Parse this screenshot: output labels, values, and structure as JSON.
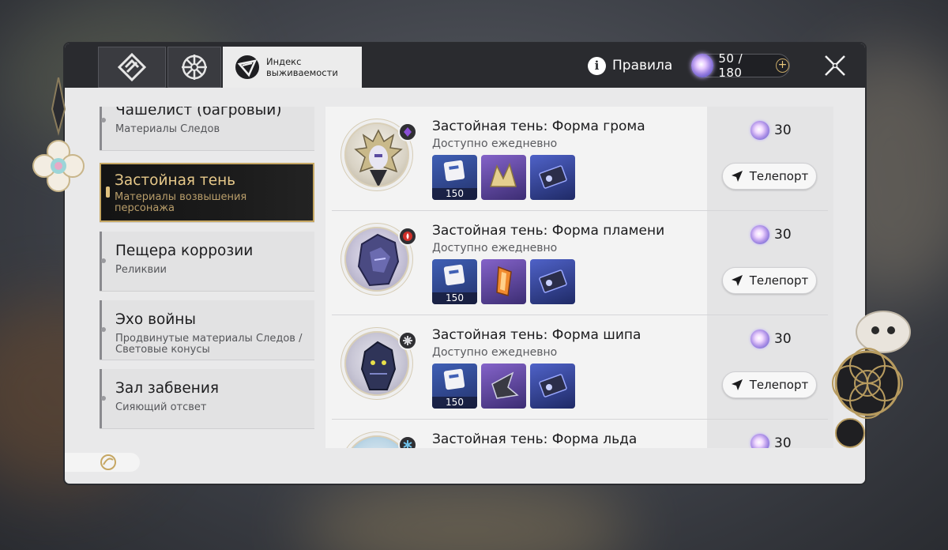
{
  "tabs": [
    {
      "icon": "rhombus-emblem-icon",
      "label": ""
    },
    {
      "icon": "compass-star-icon",
      "label": ""
    },
    {
      "icon": "survival-index-icon",
      "label": "Индекс выживаемости",
      "active": true
    }
  ],
  "header": {
    "rules_label": "Правила",
    "power": {
      "current": "50",
      "max": "180",
      "display": "50 / 180",
      "plus": "+"
    }
  },
  "nav": {
    "items": [
      {
        "title": "Чашелист (багровый)",
        "sub": "Материалы Следов"
      },
      {
        "title": "Застойная тень",
        "sub": "Материалы возвышения персонажа",
        "active": true
      },
      {
        "title": "Пещера коррозии",
        "sub": "Реликвии"
      },
      {
        "title": "Эхо войны",
        "sub": "Продвинутые материалы Следов / Световые конусы"
      },
      {
        "title": "Зал забвения",
        "sub": "Сияющий отсвет"
      }
    ]
  },
  "list": {
    "rows": [
      {
        "title": "Застойная тень: Форма грома",
        "sub": "Доступно ежедневно",
        "cost": "30",
        "teleport": "Телепорт",
        "badge_color": "#7a3fbf",
        "mats": [
          {
            "qty": "150"
          },
          {
            "qty": ""
          },
          {
            "qty": ""
          }
        ]
      },
      {
        "title": "Застойная тень: Форма пламени",
        "sub": "Доступно ежедневно",
        "cost": "30",
        "teleport": "Телепорт",
        "badge_color": "#d0302a",
        "mats": [
          {
            "qty": "150"
          },
          {
            "qty": ""
          },
          {
            "qty": ""
          }
        ]
      },
      {
        "title": "Застойная тень: Форма шипа",
        "sub": "Доступно ежедневно",
        "cost": "30",
        "teleport": "Телепорт",
        "badge_color": "#9a9aa0",
        "mats": [
          {
            "qty": "150"
          },
          {
            "qty": ""
          },
          {
            "qty": ""
          }
        ]
      },
      {
        "title": "Застойная тень: Форма льда",
        "sub": "",
        "cost": "30",
        "teleport": "",
        "badge_color": "#3f8fbf",
        "mats": []
      }
    ]
  },
  "colors": {
    "accent_gold": "#c6a763",
    "topbar": "#2a2b2f"
  }
}
